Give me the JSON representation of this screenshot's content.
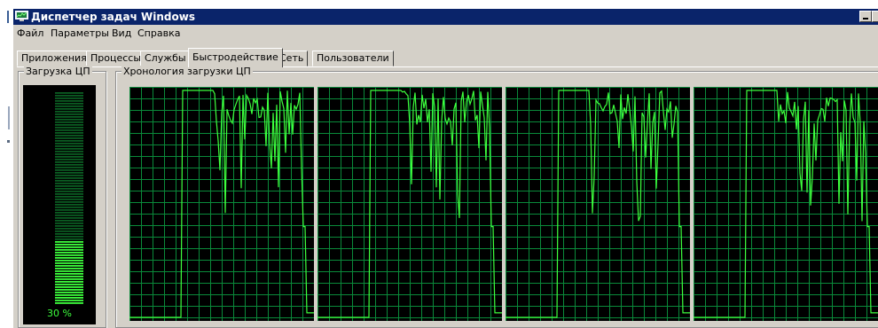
{
  "window": {
    "title": "Диспетчер задач Windows"
  },
  "menu": [
    "Файл",
    "Параметры",
    "Вид",
    "Справка"
  ],
  "tabs": [
    {
      "label": "Приложения"
    },
    {
      "label": "Процессы"
    },
    {
      "label": "Службы"
    },
    {
      "label": "Быстродействие",
      "active": true
    },
    {
      "label": "Сеть"
    },
    {
      "label": "Пользователи"
    }
  ],
  "cpu_usage": {
    "legend": "Загрузка ЦП",
    "percent_label": "30 %",
    "level": 0.3
  },
  "history": {
    "legend": "Хронология загрузки ЦП",
    "panels": 4
  },
  "colors": {
    "graph_line": "#3dff3d",
    "grid": "#0a8a3a",
    "meter_on": "#3dff3d",
    "meter_off": "#0b5c22",
    "titlebar": "#0a246a",
    "window_face": "#d4d0c8"
  }
}
